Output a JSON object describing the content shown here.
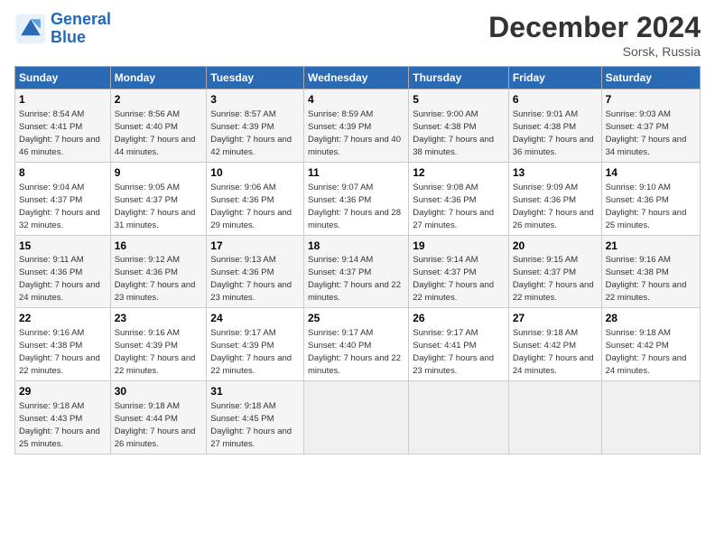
{
  "logo": {
    "line1": "General",
    "line2": "Blue"
  },
  "title": "December 2024",
  "subtitle": "Sorsk, Russia",
  "header_days": [
    "Sunday",
    "Monday",
    "Tuesday",
    "Wednesday",
    "Thursday",
    "Friday",
    "Saturday"
  ],
  "weeks": [
    [
      {
        "day": "1",
        "sunrise": "Sunrise: 8:54 AM",
        "sunset": "Sunset: 4:41 PM",
        "daylight": "Daylight: 7 hours and 46 minutes."
      },
      {
        "day": "2",
        "sunrise": "Sunrise: 8:56 AM",
        "sunset": "Sunset: 4:40 PM",
        "daylight": "Daylight: 7 hours and 44 minutes."
      },
      {
        "day": "3",
        "sunrise": "Sunrise: 8:57 AM",
        "sunset": "Sunset: 4:39 PM",
        "daylight": "Daylight: 7 hours and 42 minutes."
      },
      {
        "day": "4",
        "sunrise": "Sunrise: 8:59 AM",
        "sunset": "Sunset: 4:39 PM",
        "daylight": "Daylight: 7 hours and 40 minutes."
      },
      {
        "day": "5",
        "sunrise": "Sunrise: 9:00 AM",
        "sunset": "Sunset: 4:38 PM",
        "daylight": "Daylight: 7 hours and 38 minutes."
      },
      {
        "day": "6",
        "sunrise": "Sunrise: 9:01 AM",
        "sunset": "Sunset: 4:38 PM",
        "daylight": "Daylight: 7 hours and 36 minutes."
      },
      {
        "day": "7",
        "sunrise": "Sunrise: 9:03 AM",
        "sunset": "Sunset: 4:37 PM",
        "daylight": "Daylight: 7 hours and 34 minutes."
      }
    ],
    [
      {
        "day": "8",
        "sunrise": "Sunrise: 9:04 AM",
        "sunset": "Sunset: 4:37 PM",
        "daylight": "Daylight: 7 hours and 32 minutes."
      },
      {
        "day": "9",
        "sunrise": "Sunrise: 9:05 AM",
        "sunset": "Sunset: 4:37 PM",
        "daylight": "Daylight: 7 hours and 31 minutes."
      },
      {
        "day": "10",
        "sunrise": "Sunrise: 9:06 AM",
        "sunset": "Sunset: 4:36 PM",
        "daylight": "Daylight: 7 hours and 29 minutes."
      },
      {
        "day": "11",
        "sunrise": "Sunrise: 9:07 AM",
        "sunset": "Sunset: 4:36 PM",
        "daylight": "Daylight: 7 hours and 28 minutes."
      },
      {
        "day": "12",
        "sunrise": "Sunrise: 9:08 AM",
        "sunset": "Sunset: 4:36 PM",
        "daylight": "Daylight: 7 hours and 27 minutes."
      },
      {
        "day": "13",
        "sunrise": "Sunrise: 9:09 AM",
        "sunset": "Sunset: 4:36 PM",
        "daylight": "Daylight: 7 hours and 26 minutes."
      },
      {
        "day": "14",
        "sunrise": "Sunrise: 9:10 AM",
        "sunset": "Sunset: 4:36 PM",
        "daylight": "Daylight: 7 hours and 25 minutes."
      }
    ],
    [
      {
        "day": "15",
        "sunrise": "Sunrise: 9:11 AM",
        "sunset": "Sunset: 4:36 PM",
        "daylight": "Daylight: 7 hours and 24 minutes."
      },
      {
        "day": "16",
        "sunrise": "Sunrise: 9:12 AM",
        "sunset": "Sunset: 4:36 PM",
        "daylight": "Daylight: 7 hours and 23 minutes."
      },
      {
        "day": "17",
        "sunrise": "Sunrise: 9:13 AM",
        "sunset": "Sunset: 4:36 PM",
        "daylight": "Daylight: 7 hours and 23 minutes."
      },
      {
        "day": "18",
        "sunrise": "Sunrise: 9:14 AM",
        "sunset": "Sunset: 4:37 PM",
        "daylight": "Daylight: 7 hours and 22 minutes."
      },
      {
        "day": "19",
        "sunrise": "Sunrise: 9:14 AM",
        "sunset": "Sunset: 4:37 PM",
        "daylight": "Daylight: 7 hours and 22 minutes."
      },
      {
        "day": "20",
        "sunrise": "Sunrise: 9:15 AM",
        "sunset": "Sunset: 4:37 PM",
        "daylight": "Daylight: 7 hours and 22 minutes."
      },
      {
        "day": "21",
        "sunrise": "Sunrise: 9:16 AM",
        "sunset": "Sunset: 4:38 PM",
        "daylight": "Daylight: 7 hours and 22 minutes."
      }
    ],
    [
      {
        "day": "22",
        "sunrise": "Sunrise: 9:16 AM",
        "sunset": "Sunset: 4:38 PM",
        "daylight": "Daylight: 7 hours and 22 minutes."
      },
      {
        "day": "23",
        "sunrise": "Sunrise: 9:16 AM",
        "sunset": "Sunset: 4:39 PM",
        "daylight": "Daylight: 7 hours and 22 minutes."
      },
      {
        "day": "24",
        "sunrise": "Sunrise: 9:17 AM",
        "sunset": "Sunset: 4:39 PM",
        "daylight": "Daylight: 7 hours and 22 minutes."
      },
      {
        "day": "25",
        "sunrise": "Sunrise: 9:17 AM",
        "sunset": "Sunset: 4:40 PM",
        "daylight": "Daylight: 7 hours and 22 minutes."
      },
      {
        "day": "26",
        "sunrise": "Sunrise: 9:17 AM",
        "sunset": "Sunset: 4:41 PM",
        "daylight": "Daylight: 7 hours and 23 minutes."
      },
      {
        "day": "27",
        "sunrise": "Sunrise: 9:18 AM",
        "sunset": "Sunset: 4:42 PM",
        "daylight": "Daylight: 7 hours and 24 minutes."
      },
      {
        "day": "28",
        "sunrise": "Sunrise: 9:18 AM",
        "sunset": "Sunset: 4:42 PM",
        "daylight": "Daylight: 7 hours and 24 minutes."
      }
    ],
    [
      {
        "day": "29",
        "sunrise": "Sunrise: 9:18 AM",
        "sunset": "Sunset: 4:43 PM",
        "daylight": "Daylight: 7 hours and 25 minutes."
      },
      {
        "day": "30",
        "sunrise": "Sunrise: 9:18 AM",
        "sunset": "Sunset: 4:44 PM",
        "daylight": "Daylight: 7 hours and 26 minutes."
      },
      {
        "day": "31",
        "sunrise": "Sunrise: 9:18 AM",
        "sunset": "Sunset: 4:45 PM",
        "daylight": "Daylight: 7 hours and 27 minutes."
      },
      null,
      null,
      null,
      null
    ]
  ]
}
